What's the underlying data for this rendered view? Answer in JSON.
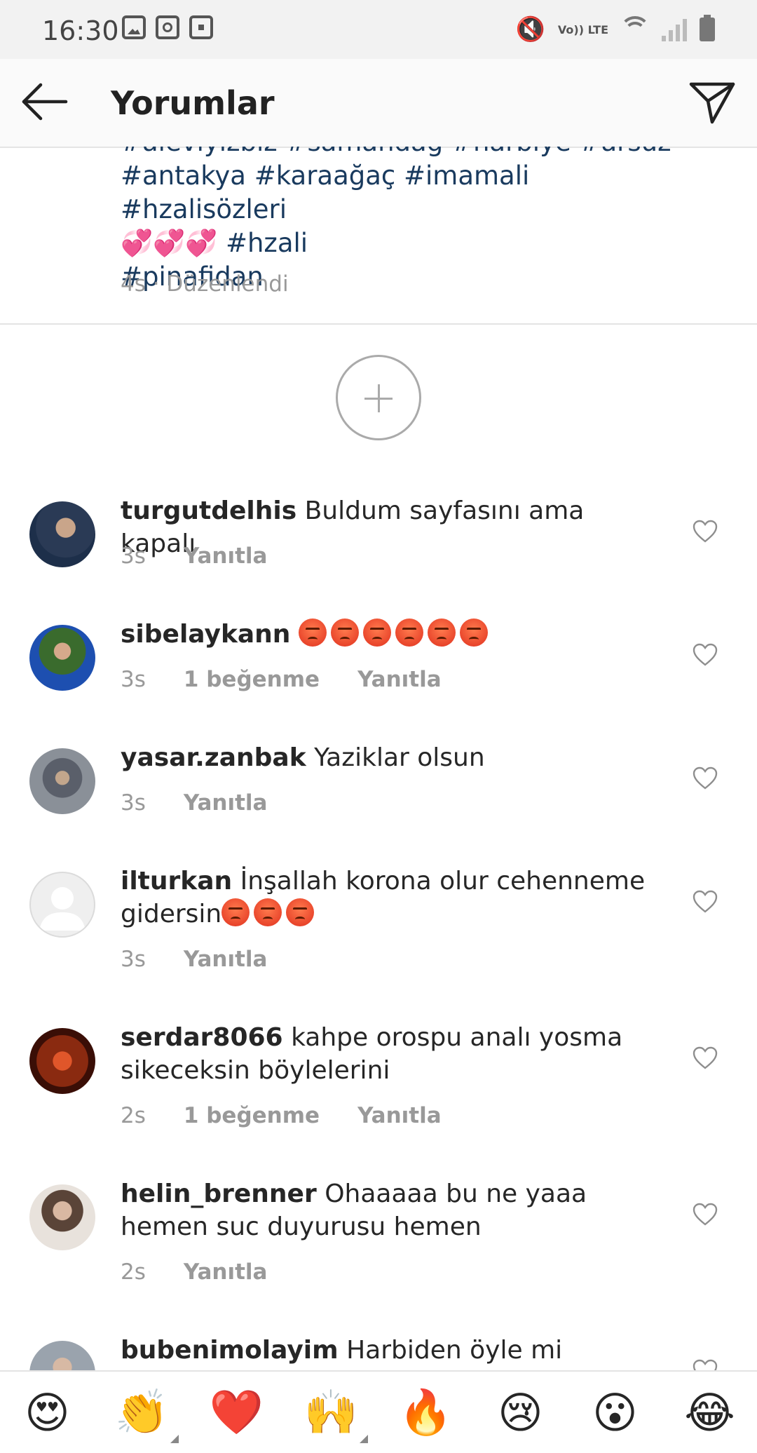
{
  "status": {
    "time": "16:30",
    "volte": "Vo)) LTE"
  },
  "header": {
    "title": "Yorumlar"
  },
  "caption": {
    "lines": [
      "#aleviyizbiz #samandağ #harbiye #arsuz",
      "#antakya #karaağaç #imamali #hzalisözleri",
      "💞💞💞 #hzali",
      "#pinafidan"
    ],
    "meta": "4s · Düzenlendi"
  },
  "comments": [
    {
      "user": "turgutdelhis",
      "text": "Buldum sayfasını ama kapalı",
      "time": "3s",
      "likes": "",
      "reply": "Yanıtla"
    },
    {
      "user": "sibelaykann",
      "text": "",
      "time": "3s",
      "likes": "1 beğenme",
      "reply": "Yanıtla"
    },
    {
      "user": "yasar.zanbak",
      "text": "Yaziklar olsun",
      "time": "3s",
      "likes": "",
      "reply": "Yanıtla"
    },
    {
      "user": "ilturkan",
      "text": "İnşallah korona olur cehenneme gidersin",
      "time": "3s",
      "likes": "",
      "reply": "Yanıtla"
    },
    {
      "user": "serdar8066",
      "text": "kahpe orospu analı yosma sikeceksin böylelerini",
      "time": "2s",
      "likes": "1 beğenme",
      "reply": "Yanıtla"
    },
    {
      "user": "helin_brenner",
      "text": "Ohaaaaa bu ne yaaa hemen suc duyurusu hemen",
      "time": "2s",
      "likes": "",
      "reply": "Yanıtla"
    },
    {
      "user": "bubenimolayim",
      "text": "Harbiden öyle mi aleviler"
    }
  ],
  "emoji_bar": [
    "😍",
    "👏",
    "❤️",
    "🙌",
    "🔥",
    "😢",
    "😮",
    "😂"
  ],
  "colors": {
    "hashtag": "#193a5e",
    "meta": "#999999",
    "divider": "#e4e4e4"
  }
}
